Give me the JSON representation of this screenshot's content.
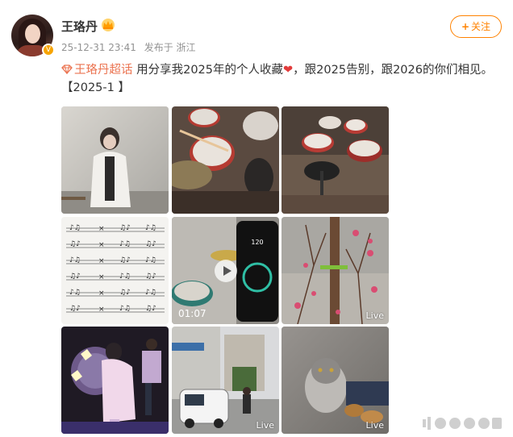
{
  "post": {
    "username": "王珞丹",
    "timestamp": "25-12-31 23:41",
    "source": "发布于 浙江",
    "follow_label": "关注",
    "topic": "王珞丹超话",
    "text_part1": "用分享我2025年的个人收藏",
    "text_part2": "，跟2025告别，跟2026的你们相见。【2025-1 】"
  },
  "icons": [
    "vip-crown-icon",
    "verified-badge-icon",
    "plus-icon",
    "topic-diamond-icon",
    "heart-emoji-icon",
    "play-icon"
  ],
  "colors": {
    "accent": "#ff8200",
    "topic": "#eb7350",
    "heart": "#e23b3b",
    "meta": "#939393"
  },
  "images": [
    {
      "id": "photo-1",
      "label": ""
    },
    {
      "id": "photo-2",
      "label": ""
    },
    {
      "id": "photo-3",
      "label": ""
    },
    {
      "id": "photo-4",
      "label": ""
    },
    {
      "id": "photo-5",
      "duration": "01:07"
    },
    {
      "id": "photo-6",
      "label": "Live"
    },
    {
      "id": "photo-7",
      "label": ""
    },
    {
      "id": "photo-8",
      "label": "Live"
    },
    {
      "id": "photo-9",
      "label": "Live"
    }
  ],
  "phone_screen": {
    "bpm": "120"
  }
}
